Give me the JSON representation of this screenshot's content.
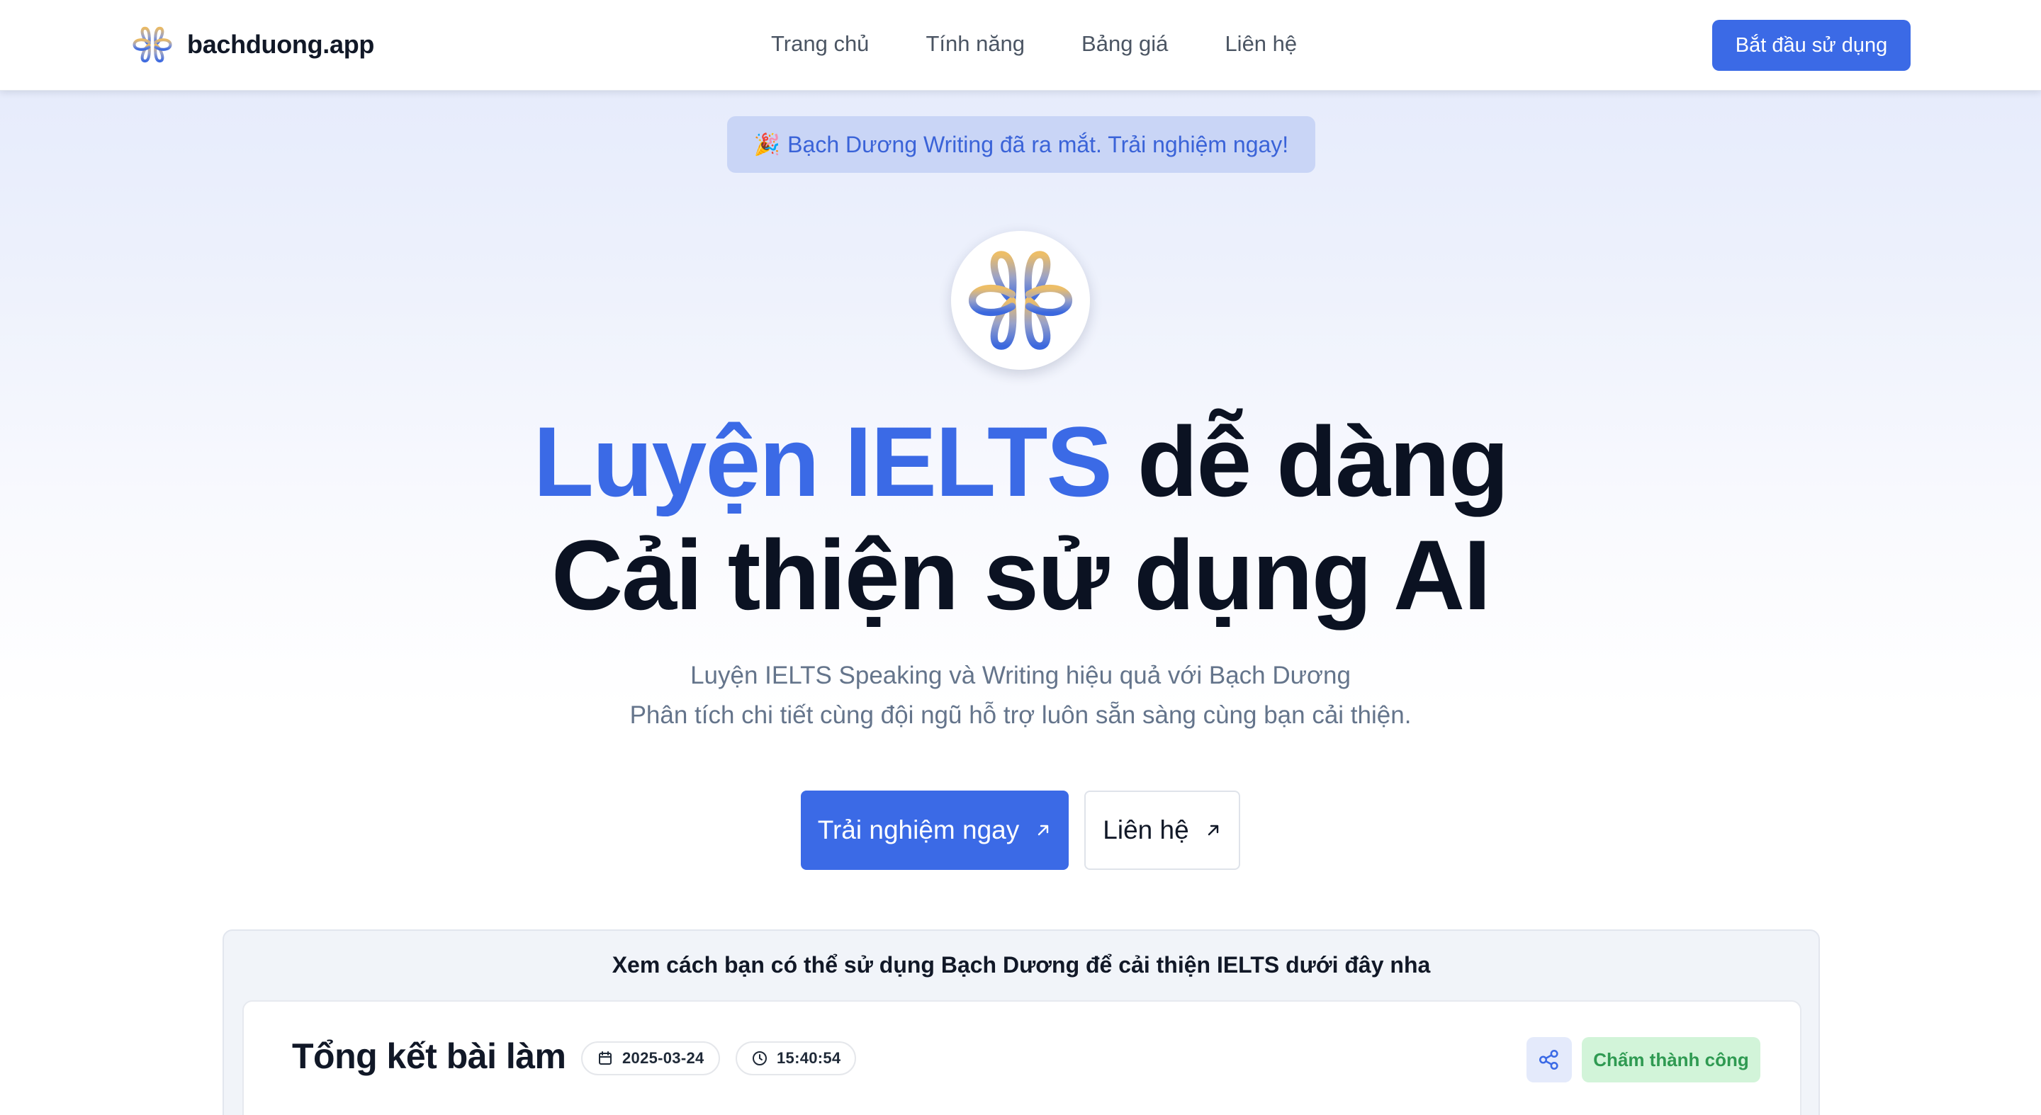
{
  "colors": {
    "accent": "#3b6ae6",
    "announcement_bg": "#c9d5f6",
    "status_success_bg": "#d2f4d9",
    "status_success_text": "#2f9a52",
    "headline": "#0b1222",
    "muted_text": "#64748b"
  },
  "navbar": {
    "brand": {
      "name": "bachduong.app",
      "logo_icon": "bachduong-logo-icon"
    },
    "links": [
      {
        "label": "Trang chủ"
      },
      {
        "label": "Tính năng"
      },
      {
        "label": "Bảng giá"
      },
      {
        "label": "Liên hệ"
      }
    ],
    "cta_label": "Bắt đầu sử dụng"
  },
  "announcement": {
    "icon": "🎉",
    "text": "Bạch Dương Writing đã ra mắt. Trải nghiệm ngay!"
  },
  "hero": {
    "logo_icon": "bachduong-logo-icon",
    "headline": {
      "accent": "Luyện IELTS",
      "line1_rest": " dễ dàng",
      "line2": "Cải thiện sử dụng AI"
    },
    "subtitle": {
      "line1": "Luyện IELTS Speaking và Writing hiệu quả với Bạch Dương",
      "line2": "Phân tích chi tiết cùng đội ngũ hỗ trợ luôn sẵn sàng cùng bạn cải thiện."
    },
    "primary_button": {
      "label": "Trải nghiệm ngay",
      "icon": "arrow-up-right-icon"
    },
    "secondary_button": {
      "label": "Liên hệ",
      "icon": "arrow-up-right-icon"
    }
  },
  "demo": {
    "caption": "Xem cách bạn có thể sử dụng Bạch Dương để cải thiện IELTS dưới đây nha",
    "card": {
      "title": "Tổng kết bài làm",
      "date": "2025-03-24",
      "time": "15:40:54",
      "share_icon": "share-icon",
      "status": "Chấm thành công"
    }
  }
}
